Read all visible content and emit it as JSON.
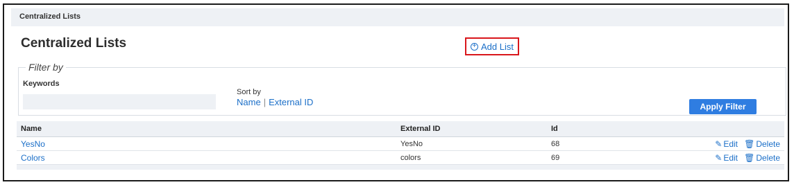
{
  "breadcrumb": {
    "label": "Centralized Lists"
  },
  "page": {
    "title": "Centralized Lists"
  },
  "toolbar": {
    "add_list_label": "Add List",
    "add_list_icon": "plus-circle-icon",
    "highlight_color": "#d9161b"
  },
  "filter": {
    "legend": "Filter by",
    "keywords_label": "Keywords",
    "keywords_value": "",
    "sort_label": "Sort by",
    "sort_options": [
      "Name",
      "External ID"
    ],
    "apply_label": "Apply Filter"
  },
  "table": {
    "columns": [
      "Name",
      "External ID",
      "Id"
    ],
    "rows": [
      {
        "name": "YesNo",
        "external_id": "YesNo",
        "id": "68",
        "edit": "Edit",
        "delete": "Delete"
      },
      {
        "name": "Colors",
        "external_id": "colors",
        "id": "69",
        "edit": "Edit",
        "delete": "Delete"
      }
    ]
  },
  "colors": {
    "link": "#1b6fc8",
    "primary_button": "#2f7de1",
    "header_bg": "#eef1f5"
  }
}
